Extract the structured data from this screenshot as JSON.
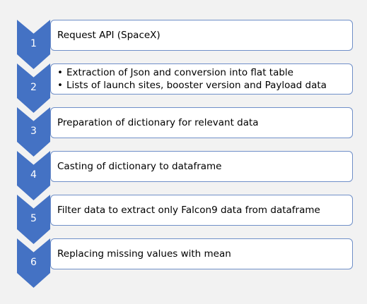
{
  "colors": {
    "chevron": "#4472c4",
    "box_border": "#6f8fc8",
    "box_fill": "#ffffff",
    "background": "#f2f2f2"
  },
  "steps": [
    {
      "number": "1",
      "text": "Request API (SpaceX)"
    },
    {
      "number": "2",
      "bullets": [
        "Extraction of Json and conversion into flat table",
        "Lists of launch sites, booster version and Payload data"
      ]
    },
    {
      "number": "3",
      "text": "Preparation of dictionary for relevant data"
    },
    {
      "number": "4",
      "text": "Casting of dictionary to dataframe"
    },
    {
      "number": "5",
      "text": "Filter data to extract only Falcon9 data from dataframe"
    },
    {
      "number": "6",
      "text": "Replacing missing values with mean"
    }
  ]
}
